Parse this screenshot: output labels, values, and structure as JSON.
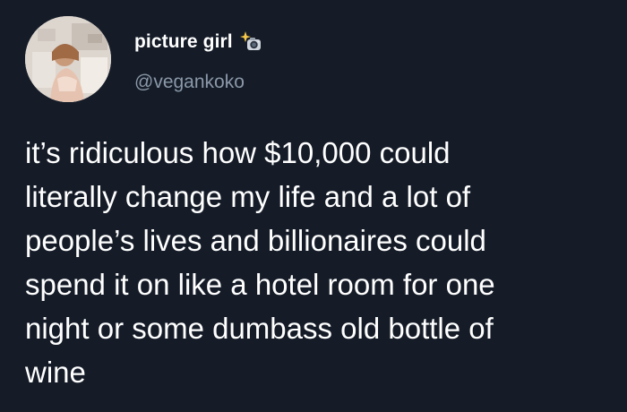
{
  "tweet": {
    "display_name": "picture girl",
    "handle": "@vegankoko",
    "text": "it’s ridiculous how $10,000 could\nliterally change my life and a lot of\npeople’s lives and billionaires could\nspend it on like a hotel room for one\nnight or some dumbass old bottle of\nwine",
    "name_badge_icon": "sparkle-camera-emoji",
    "background_color": "#151c28",
    "text_color": "#ffffff",
    "handle_color": "#8a98a8"
  }
}
